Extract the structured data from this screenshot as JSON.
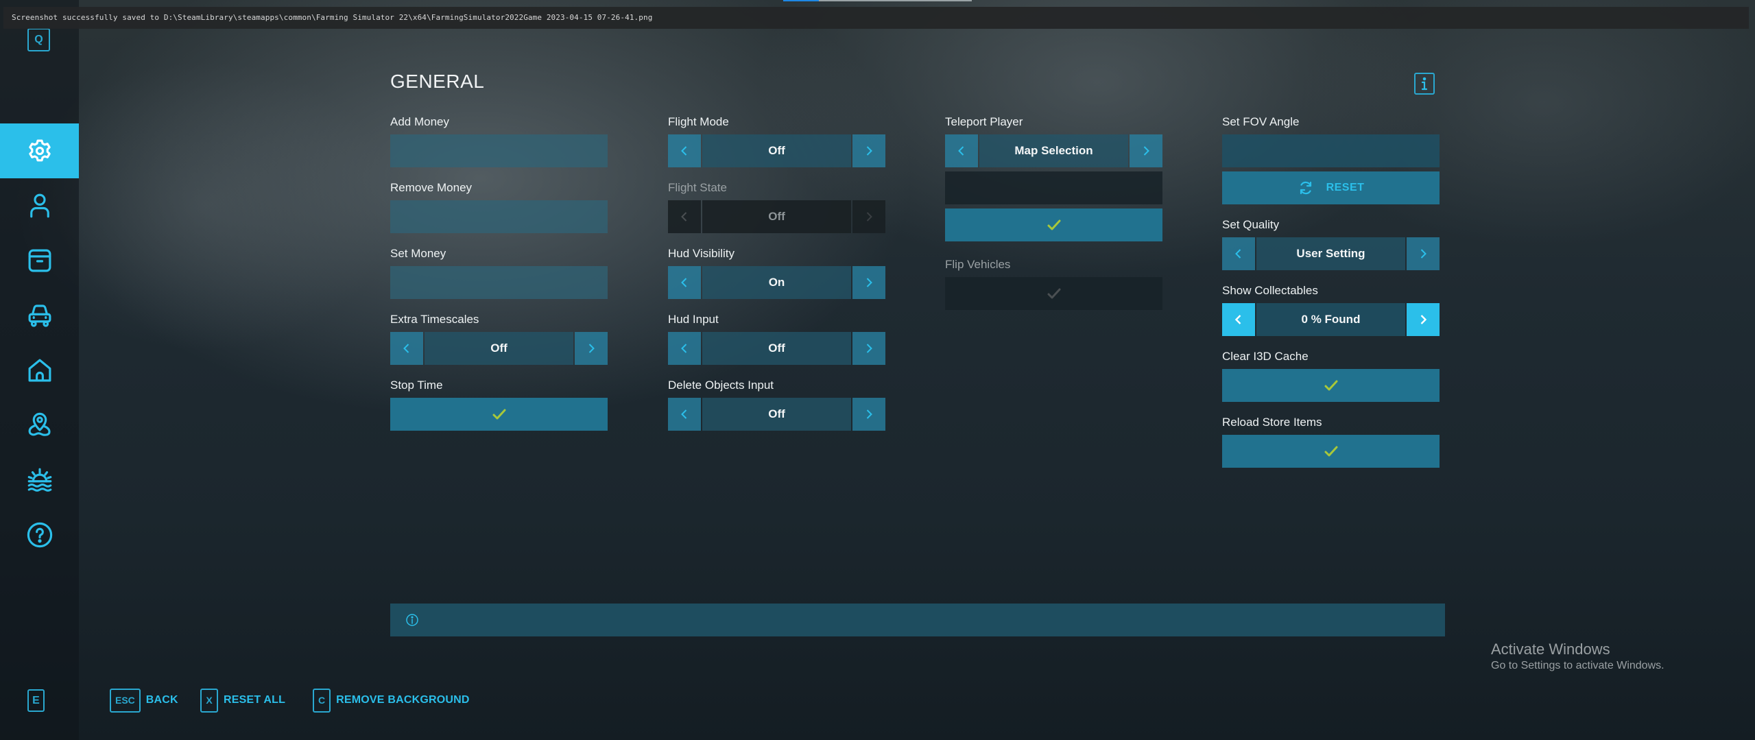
{
  "notification": {
    "text": "Screenshot successfully saved to D:\\SteamLibrary\\steamapps\\common\\Farming Simulator 22\\x64\\FarmingSimulator2022Game 2023-04-15 07-26-41.png"
  },
  "top_progress": {
    "fraction": 0.19
  },
  "sidebar": {
    "top_key": "Q",
    "bottom_key": "E",
    "items": [
      {
        "name": "general",
        "icon": "gear-icon",
        "active": true
      },
      {
        "name": "player",
        "icon": "person-icon",
        "active": false
      },
      {
        "name": "storage",
        "icon": "archive-box-icon",
        "active": false
      },
      {
        "name": "vehicles",
        "icon": "car-icon",
        "active": false
      },
      {
        "name": "farm",
        "icon": "house-icon",
        "active": false
      },
      {
        "name": "map",
        "icon": "map-pin-icon",
        "active": false
      },
      {
        "name": "environment",
        "icon": "sun-water-icon",
        "active": false
      },
      {
        "name": "help",
        "icon": "question-circle-icon",
        "active": false
      }
    ]
  },
  "page": {
    "title": "GENERAL",
    "info_icon": "info-icon"
  },
  "columns": {
    "col1": {
      "add_money": {
        "label": "Add Money",
        "value": ""
      },
      "remove_money": {
        "label": "Remove Money",
        "value": ""
      },
      "set_money": {
        "label": "Set Money",
        "value": ""
      },
      "extra_timescales": {
        "label": "Extra Timescales",
        "value": "Off"
      },
      "stop_time": {
        "label": "Stop Time",
        "icon": "checkmark-icon"
      }
    },
    "col2": {
      "flight_mode": {
        "label": "Flight Mode",
        "value": "Off"
      },
      "flight_state": {
        "label": "Flight State",
        "value": "Off",
        "disabled": true
      },
      "hud_visibility": {
        "label": "Hud Visibility",
        "value": "On"
      },
      "hud_input": {
        "label": "Hud Input",
        "value": "Off"
      },
      "delete_objects_input": {
        "label": "Delete Objects Input",
        "value": "Off"
      }
    },
    "col3": {
      "teleport_player": {
        "label": "Teleport Player",
        "value": "Map Selection",
        "input_value": ""
      },
      "flip_vehicles": {
        "label": "Flip Vehicles",
        "disabled": true
      }
    },
    "col4": {
      "set_fov_angle": {
        "label": "Set FOV Angle",
        "value": "",
        "reset_label": "RESET"
      },
      "set_quality": {
        "label": "Set Quality",
        "value": "User Setting"
      },
      "show_collectables": {
        "label": "Show Collectables",
        "value": "0 % Found"
      },
      "clear_i3d_cache": {
        "label": "Clear I3D Cache"
      },
      "reload_store_items": {
        "label": "Reload Store Items"
      }
    }
  },
  "info_bar": {
    "text": ""
  },
  "footer": {
    "back": {
      "key": "ESC",
      "label": "BACK"
    },
    "reset_all": {
      "key": "X",
      "label": "RESET ALL"
    },
    "remove_background": {
      "key": "C",
      "label": "REMOVE BACKGROUND"
    }
  },
  "windows_watermark": {
    "title": "Activate Windows",
    "subtitle": "Go to Settings to activate Windows."
  },
  "colors": {
    "accent": "#2bbfea",
    "button": "#21728f",
    "check": "#a8c83a",
    "disabled_check": "#4a4f52"
  }
}
